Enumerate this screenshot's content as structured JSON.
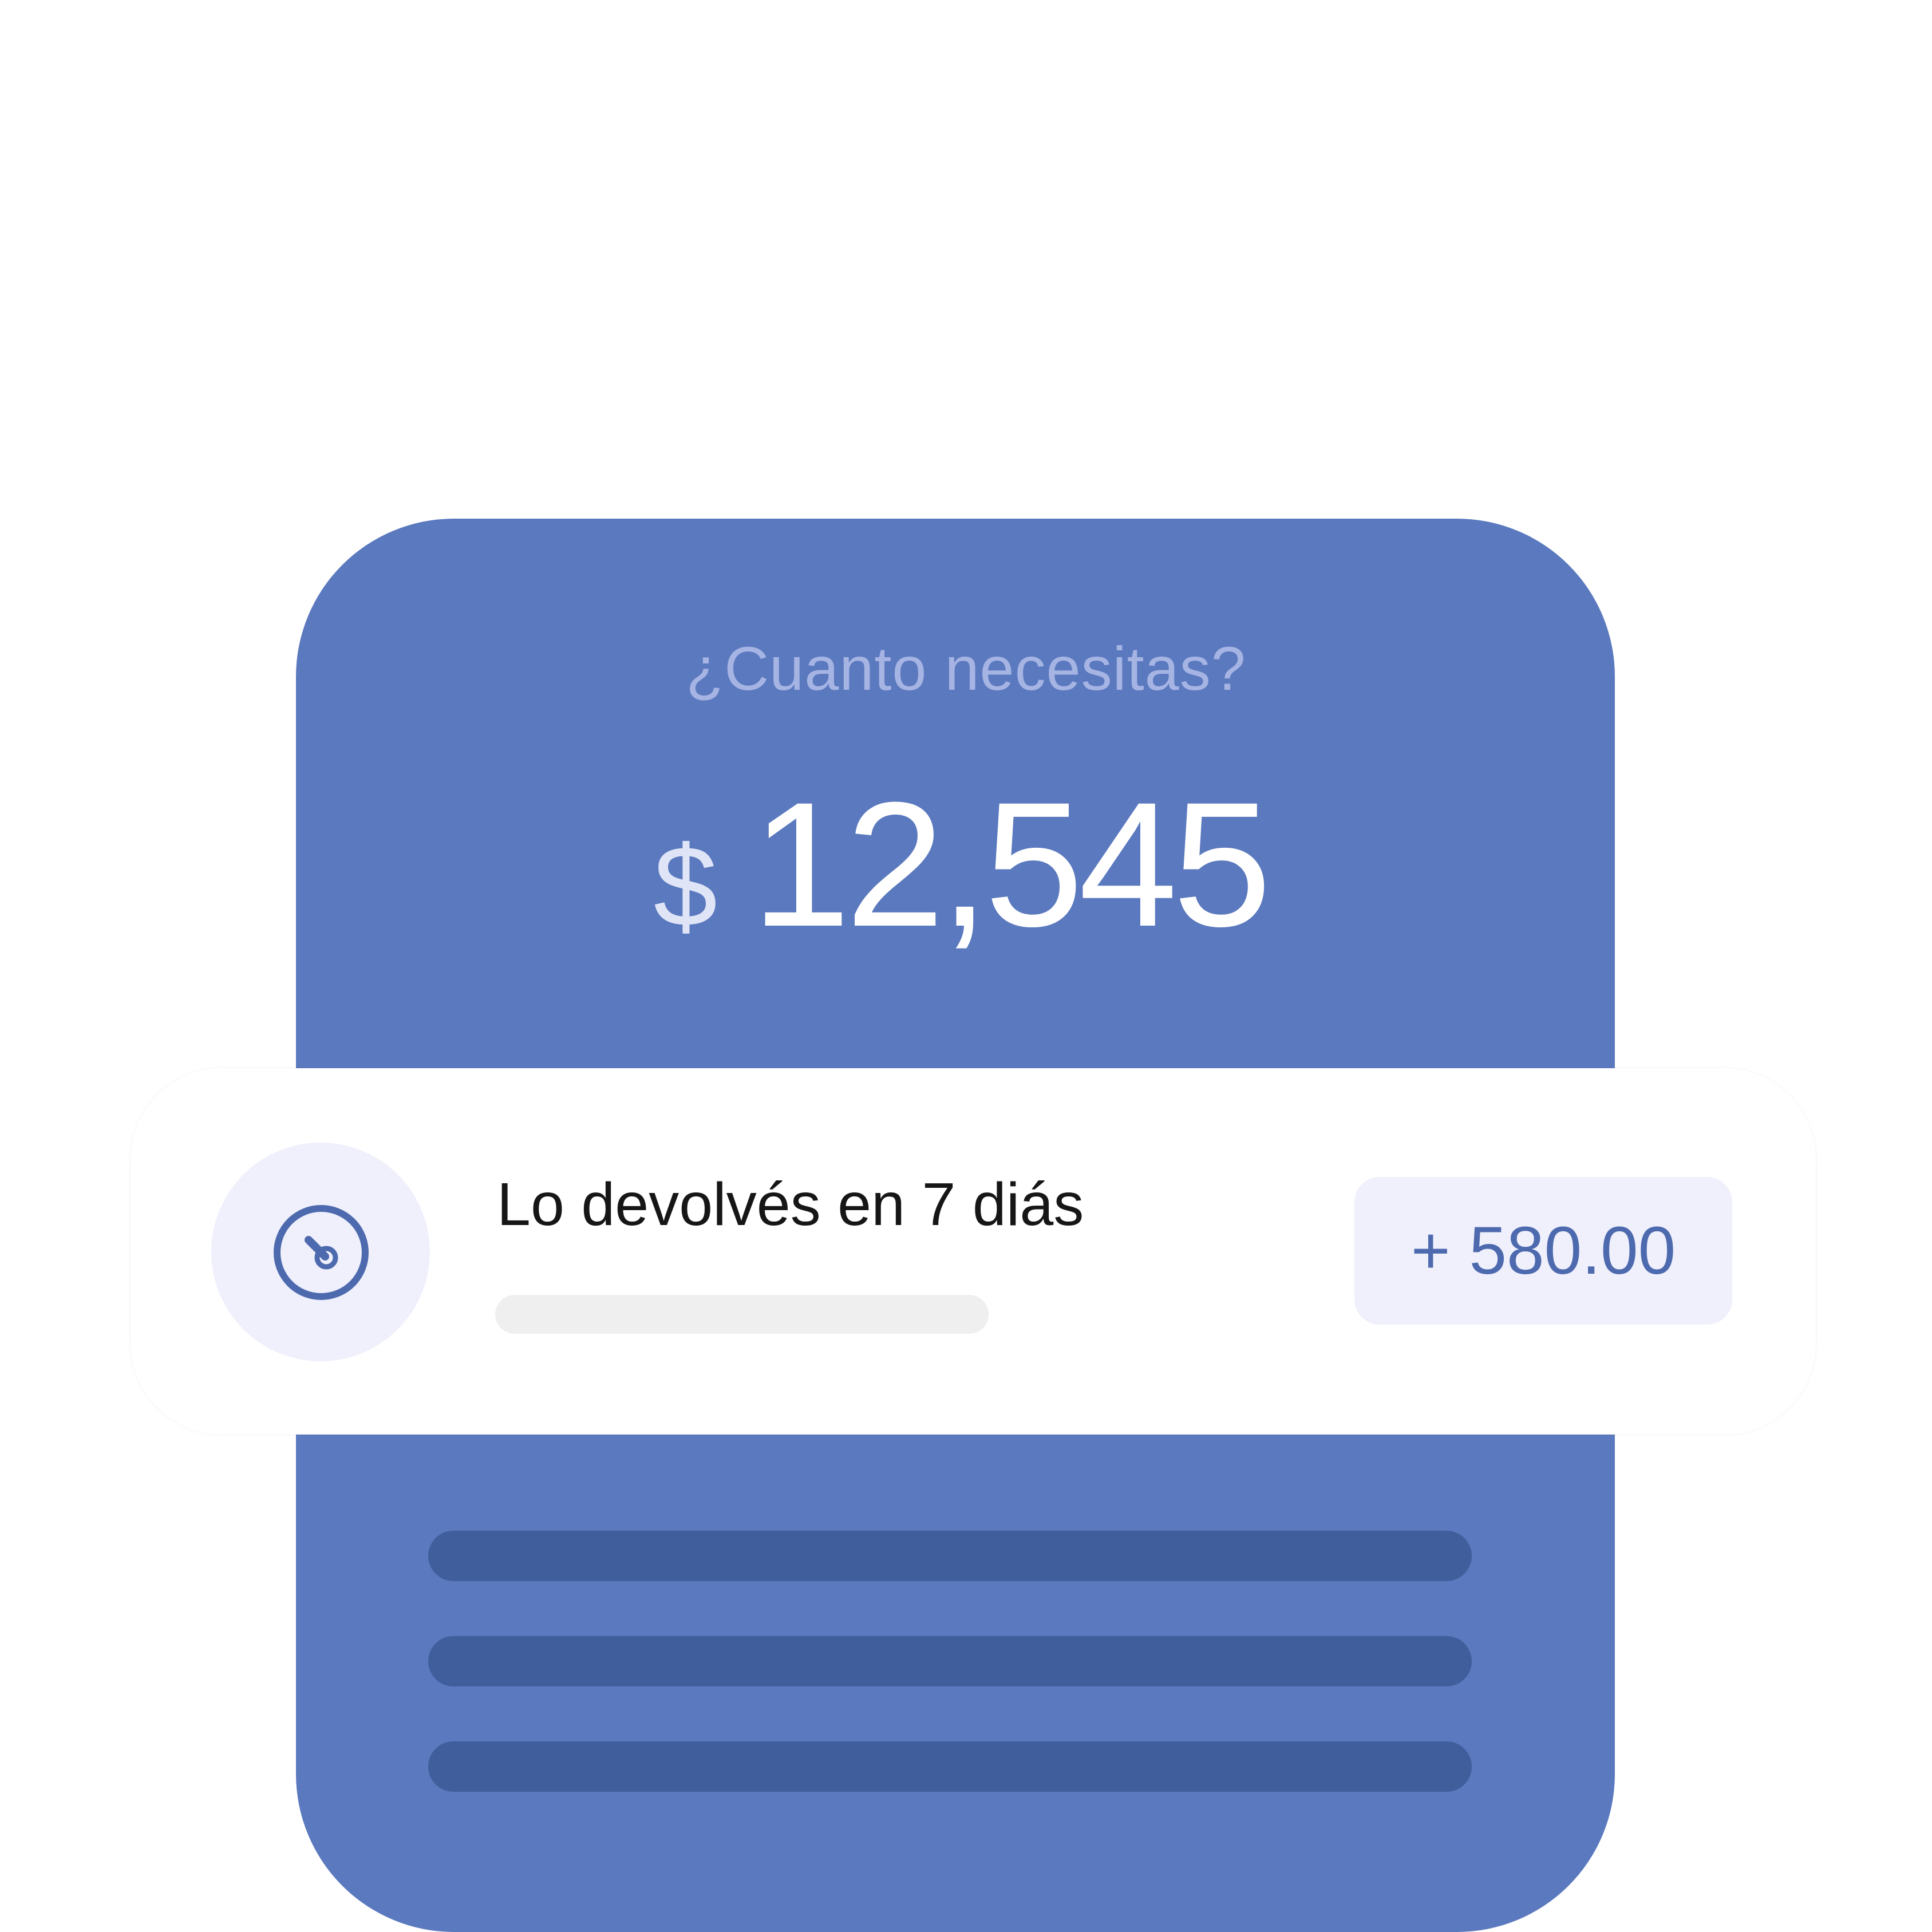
{
  "header": {
    "question": "¿Cuanto necesitas?",
    "currency_symbol": "$",
    "amount": "12,545"
  },
  "repayment": {
    "icon": "timer-icon",
    "title": "Lo devolvés en 7 diás",
    "badge": "+ 580.00"
  },
  "colors": {
    "card_background": "#5b79be",
    "placeholder_bar": "#3f5e9b",
    "badge_background": "#eff0fc",
    "badge_text": "#4e6aae"
  }
}
